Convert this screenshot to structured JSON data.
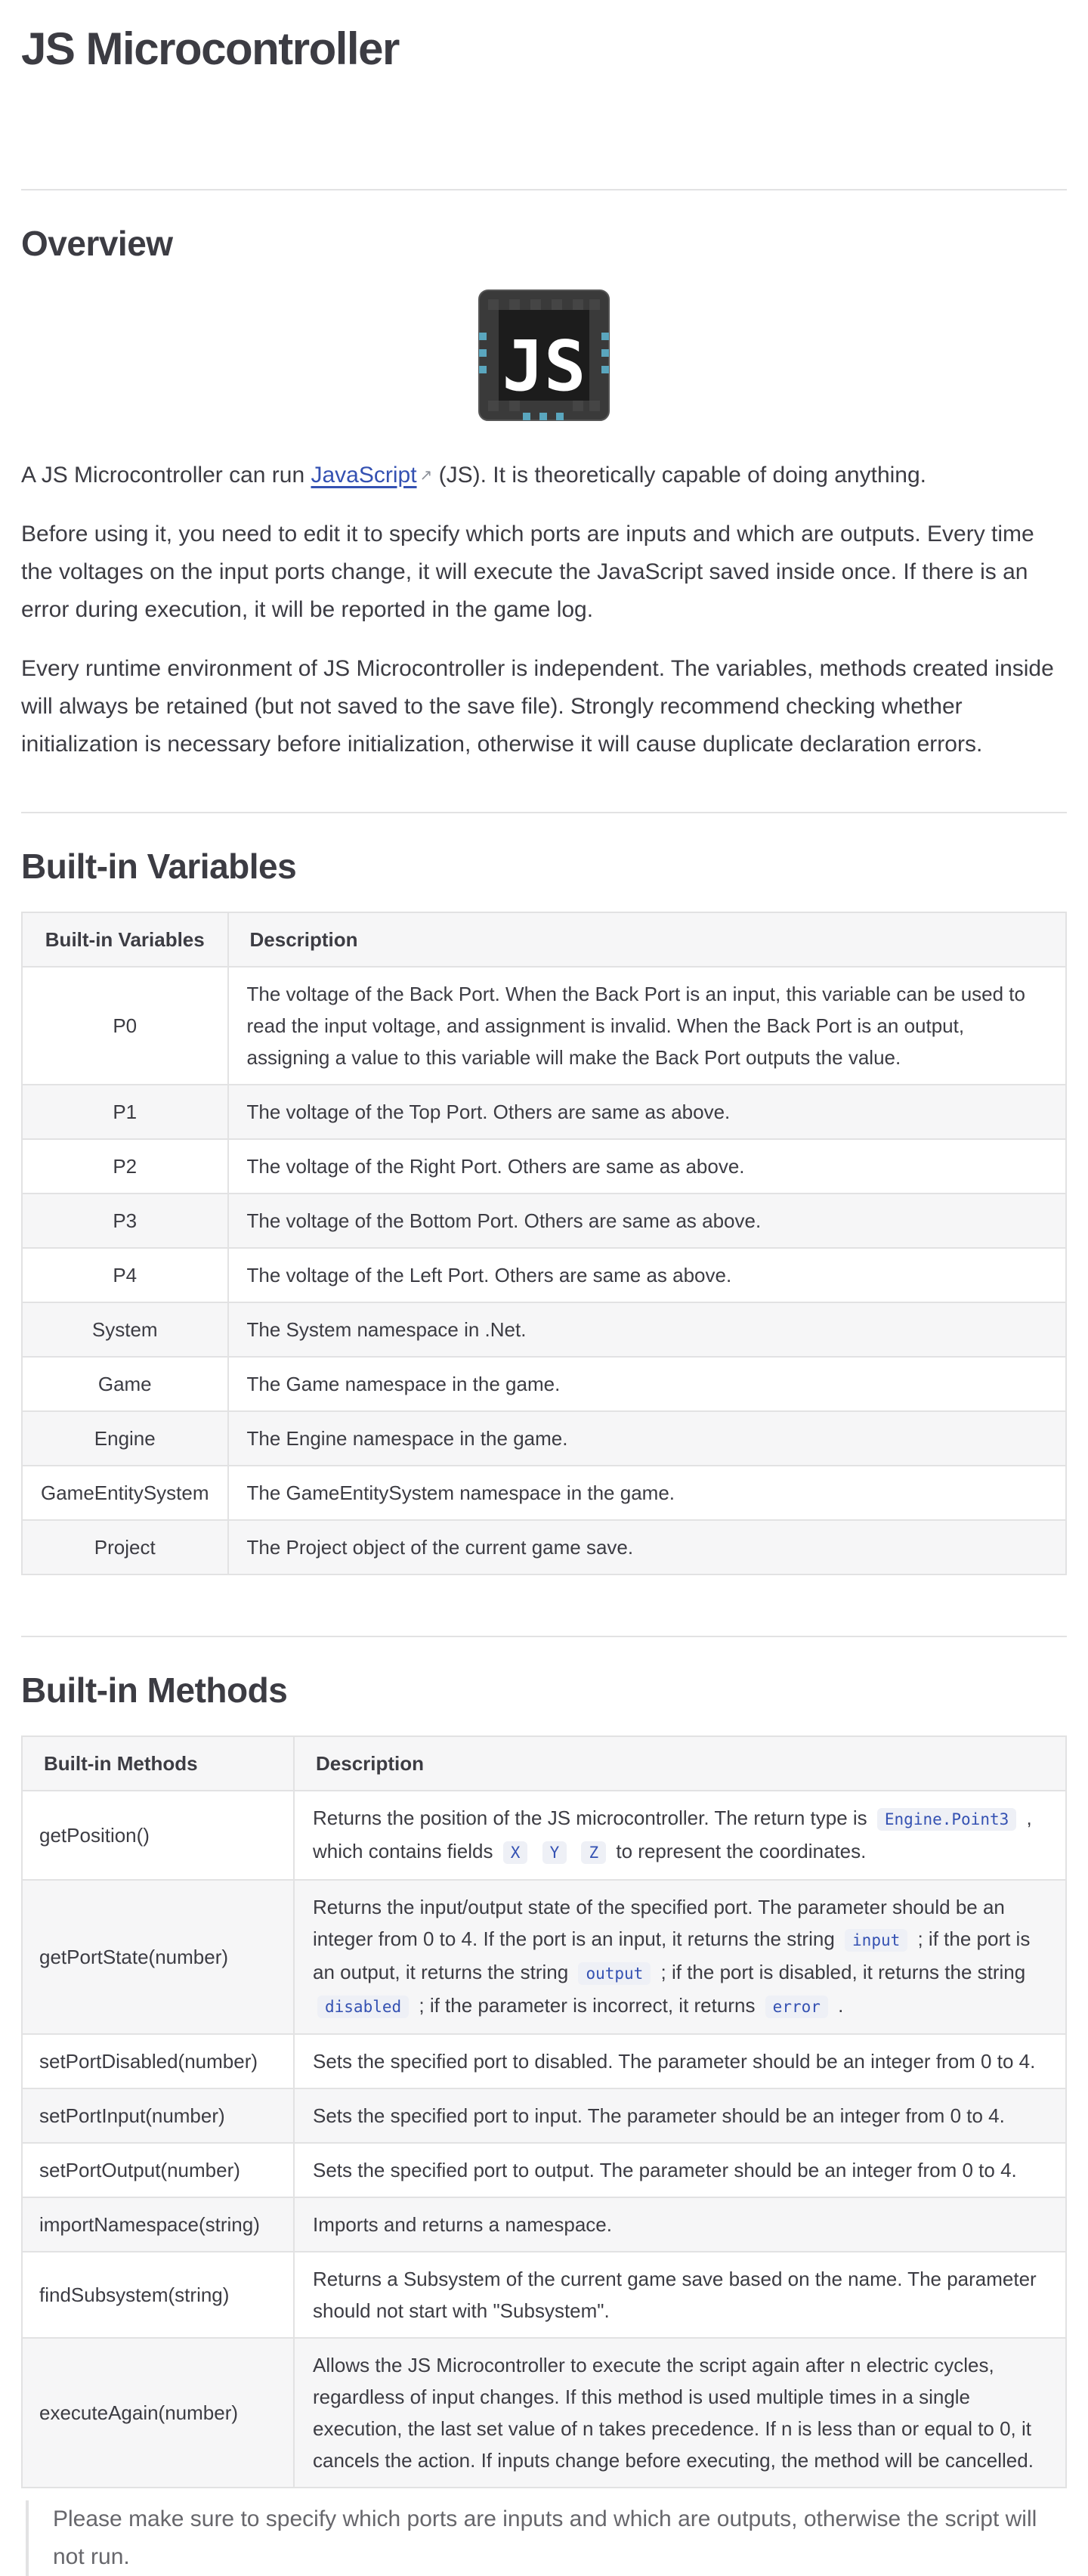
{
  "page_title": "JS Microcontroller",
  "overview": {
    "heading": "Overview",
    "logo_text": "JS",
    "para1_before": "A JS Microcontroller can run ",
    "para1_link": "JavaScript",
    "para1_link_icon": "external-link-icon",
    "para1_after": " (JS). It is theoretically capable of doing anything.",
    "para2": "Before using it, you need to edit it to specify which ports are inputs and which are outputs. Every time the voltages on the input ports change, it will execute the JavaScript saved inside once. If there is an error during execution, it will be reported in the game log.",
    "para3": "Every runtime environment of JS Microcontroller is independent. The variables, methods created inside will always be retained (but not saved to the save file). Strongly recommend checking whether initialization is necessary before initialization, otherwise it will cause duplicate declaration errors."
  },
  "variables": {
    "heading": "Built-in Variables",
    "headers": [
      "Built-in Variables",
      "Description"
    ],
    "rows": [
      {
        "name": "P0",
        "desc": "The voltage of the Back Port. When the Back Port is an input, this variable can be used to read the input voltage, and assignment is invalid. When the Back Port is an output, assigning a value to this variable will make the Back Port outputs the value."
      },
      {
        "name": "P1",
        "desc": "The voltage of the Top Port. Others are same as above."
      },
      {
        "name": "P2",
        "desc": "The voltage of the Right Port. Others are same as above."
      },
      {
        "name": "P3",
        "desc": "The voltage of the Bottom Port. Others are same as above."
      },
      {
        "name": "P4",
        "desc": "The voltage of the Left Port. Others are same as above."
      },
      {
        "name": "System",
        "desc": "The System namespace in .Net."
      },
      {
        "name": "Game",
        "desc": "The Game namespace in the game."
      },
      {
        "name": "Engine",
        "desc": "The Engine namespace in the game."
      },
      {
        "name": "GameEntitySystem",
        "desc": "The GameEntitySystem namespace in the game."
      },
      {
        "name": "Project",
        "desc": "The Project object of the current game save."
      }
    ]
  },
  "methods": {
    "heading": "Built-in Methods",
    "headers": [
      "Built-in Methods",
      "Description"
    ],
    "getPosition": {
      "name": "getPosition()",
      "t1": "Returns the position of the JS microcontroller. The return type is",
      "c1": "Engine.Point3",
      "t2": ", which contains fields",
      "c2": "X",
      "c3": "Y",
      "c4": "Z",
      "t3": "to represent the coordinates."
    },
    "getPortState": {
      "name": "getPortState(number)",
      "t1": "Returns the input/output state of the specified port. The parameter should be an integer from 0 to 4. If the port is an input, it returns the string",
      "c1": "input",
      "t2": "; if the port is an output, it returns the string",
      "c2": "output",
      "t3": "; if the port is disabled, it returns the string",
      "c3": "disabled",
      "t4": "; if the parameter is incorrect, it returns",
      "c4": "error",
      "t5": "."
    },
    "setPortDisabled": {
      "name": "setPortDisabled(number)",
      "desc": "Sets the specified port to disabled. The parameter should be an integer from 0 to 4."
    },
    "setPortInput": {
      "name": "setPortInput(number)",
      "desc": "Sets the specified port to input. The parameter should be an integer from 0 to 4."
    },
    "setPortOutput": {
      "name": "setPortOutput(number)",
      "desc": "Sets the specified port to output. The parameter should be an integer from 0 to 4."
    },
    "importNamespace": {
      "name": "importNamespace(string)",
      "desc": "Imports and returns a namespace."
    },
    "findSubsystem": {
      "name": "findSubsystem(string)",
      "desc": "Returns a Subsystem of the current game save based on the name. The parameter should not start with \"Subsystem\"."
    },
    "executeAgain": {
      "name": "executeAgain(number)",
      "desc": "Allows the JS Microcontroller to execute the script again after n electric cycles, regardless of input changes. If this method is used multiple times in a single execution, the last set value of n takes precedence. If n is less than or equal to 0, it cancels the action. If inputs change before executing, the method will be cancelled."
    }
  },
  "tip": "Please make sure to specify which ports are inputs and which are outputs, otherwise the script will not run.",
  "colors": {
    "link": "#3451b2",
    "code_bg": "#eef0f6",
    "border": "#e2e2e3",
    "row_alt": "#f6f6f7",
    "logo_accent": "#5aa6be"
  }
}
